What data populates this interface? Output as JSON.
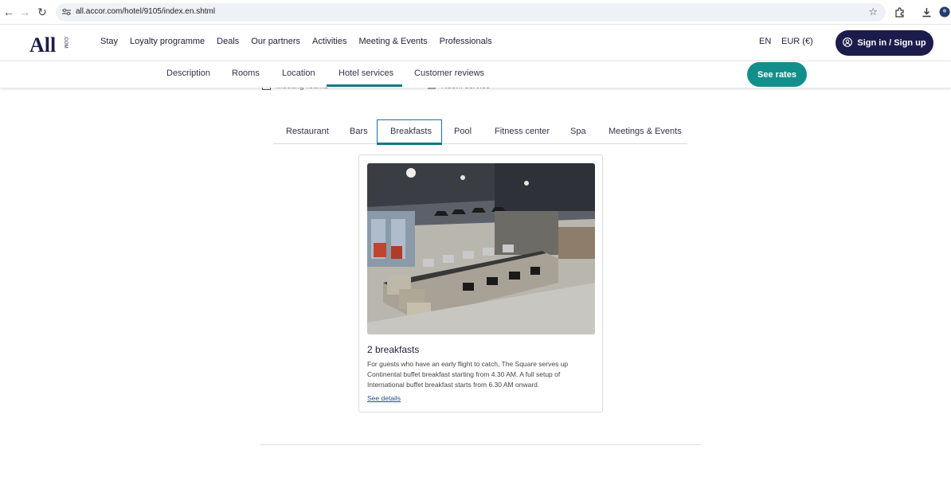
{
  "browser": {
    "url": "all.accor.com/hotel/9105/index.en.shtml"
  },
  "header": {
    "nav": [
      "Stay",
      "Loyalty programme",
      "Deals",
      "Our partners",
      "Activities",
      "Meeting & Events",
      "Professionals"
    ],
    "language": "EN",
    "currency": "EUR (€)",
    "signin_label": "Sign in / Sign up",
    "brand_color": "#1c1c4c"
  },
  "subnav": {
    "tabs": [
      "Description",
      "Rooms",
      "Location",
      "Hotel services",
      "Customer reviews"
    ],
    "active": "Hotel services",
    "see_rates": "See rates",
    "accent": "#138f8b"
  },
  "prev_section": {
    "left_label": "Meeting rooms",
    "right_label": "Room service"
  },
  "services": {
    "tabs": [
      "Restaurant",
      "Bars",
      "Breakfasts",
      "Pool",
      "Fitness center",
      "Spa",
      "Meetings & Events"
    ],
    "active": "Breakfasts"
  },
  "card": {
    "title": "2 breakfasts",
    "description": "For guests who have an early flight to catch, The Square serves up Continental buffet breakfast starting from 4.30 AM. A full setup of International buffet breakfast starts from 6.30 AM onward.",
    "link": "See details"
  }
}
